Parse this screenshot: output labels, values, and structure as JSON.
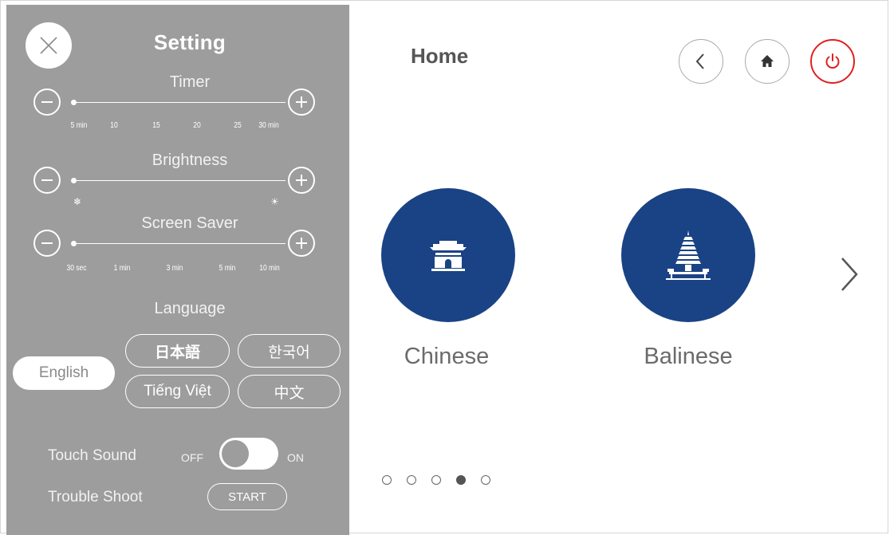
{
  "settings": {
    "title": "Setting",
    "timer": {
      "title": "Timer",
      "ticks": [
        "5 min",
        "10",
        "15",
        "20",
        "25",
        "30 min"
      ],
      "value": "5 min"
    },
    "brightness": {
      "title": "Brightness",
      "low_icon": "❄",
      "high_icon": "☀",
      "value_fraction": 0
    },
    "screen_saver": {
      "title": "Screen Saver",
      "ticks": [
        "30 sec",
        "1 min",
        "3 min",
        "5 min",
        "10 min"
      ],
      "value": "30 sec"
    },
    "language": {
      "title": "Language",
      "options": [
        "English",
        "日本語",
        "한국어",
        "Tiếng Việt",
        "中文"
      ],
      "selected": "English"
    },
    "touch_sound": {
      "label": "Touch Sound",
      "off_label": "OFF",
      "on_label": "ON",
      "state": "ON"
    },
    "trouble_shoot": {
      "label": "Trouble Shoot",
      "button_label": "START"
    }
  },
  "home": {
    "title": "Home",
    "cuisines": [
      {
        "label": "Chinese",
        "icon": "chinese-gate-icon"
      },
      {
        "label": "Balinese",
        "icon": "balinese-pagoda-icon"
      }
    ],
    "page_count": 5,
    "active_page": 4
  },
  "colors": {
    "panel_bg": "#9d9d9d",
    "accent_blue": "#1a4385",
    "power_red": "#e02020",
    "text_gray": "#6b6b6b"
  }
}
